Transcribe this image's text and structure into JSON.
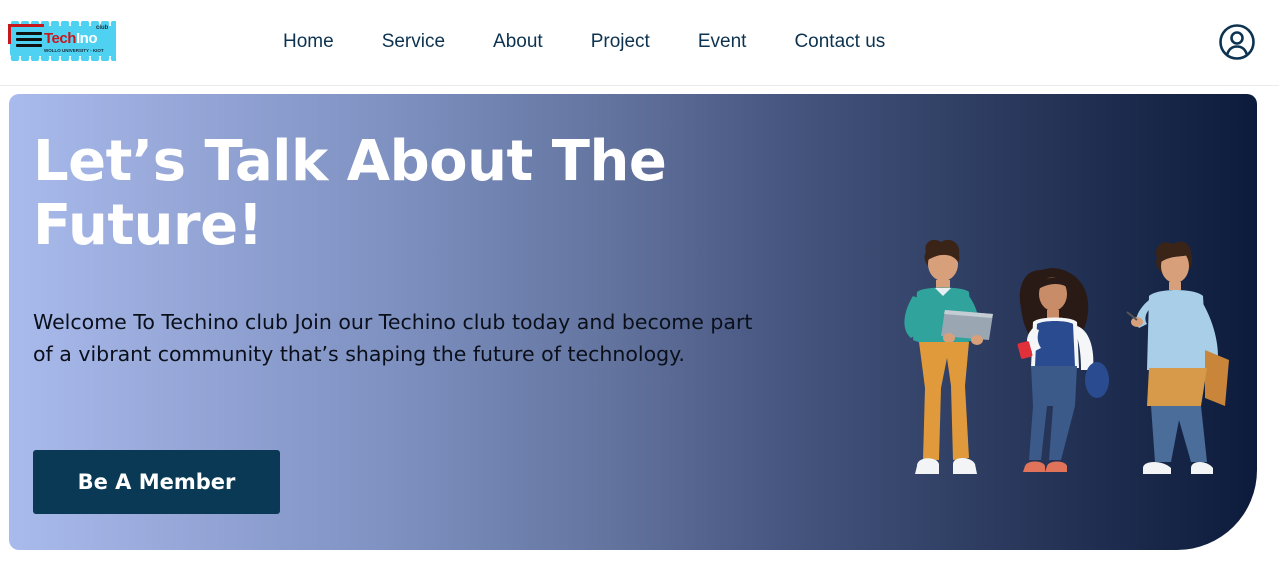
{
  "brand": {
    "name_part1": "Tech",
    "name_part2": "Ino",
    "club": "club",
    "subtitle": "WOLLO UNIVERSITY - KIOT",
    "colors": {
      "cyan": "#4fd2f2",
      "red": "#c8161d",
      "dark": "#111111"
    }
  },
  "nav": {
    "items": [
      {
        "label": "Home"
      },
      {
        "label": "Service"
      },
      {
        "label": "About"
      },
      {
        "label": "Project"
      },
      {
        "label": "Event"
      },
      {
        "label": "Contact us"
      }
    ],
    "user_icon": "user-circle-icon"
  },
  "hero": {
    "title": "Let’s Talk About The Future!",
    "description": "Welcome To Techino club Join our Techino club today and become part of a vibrant community that’s shaping the future of technology.",
    "cta_label": "Be A Member",
    "colors": {
      "cta": "#093954",
      "gradient_start": "#a9bbec",
      "gradient_end": "#0c1b3b"
    },
    "illustration": "three-students-illustration"
  }
}
